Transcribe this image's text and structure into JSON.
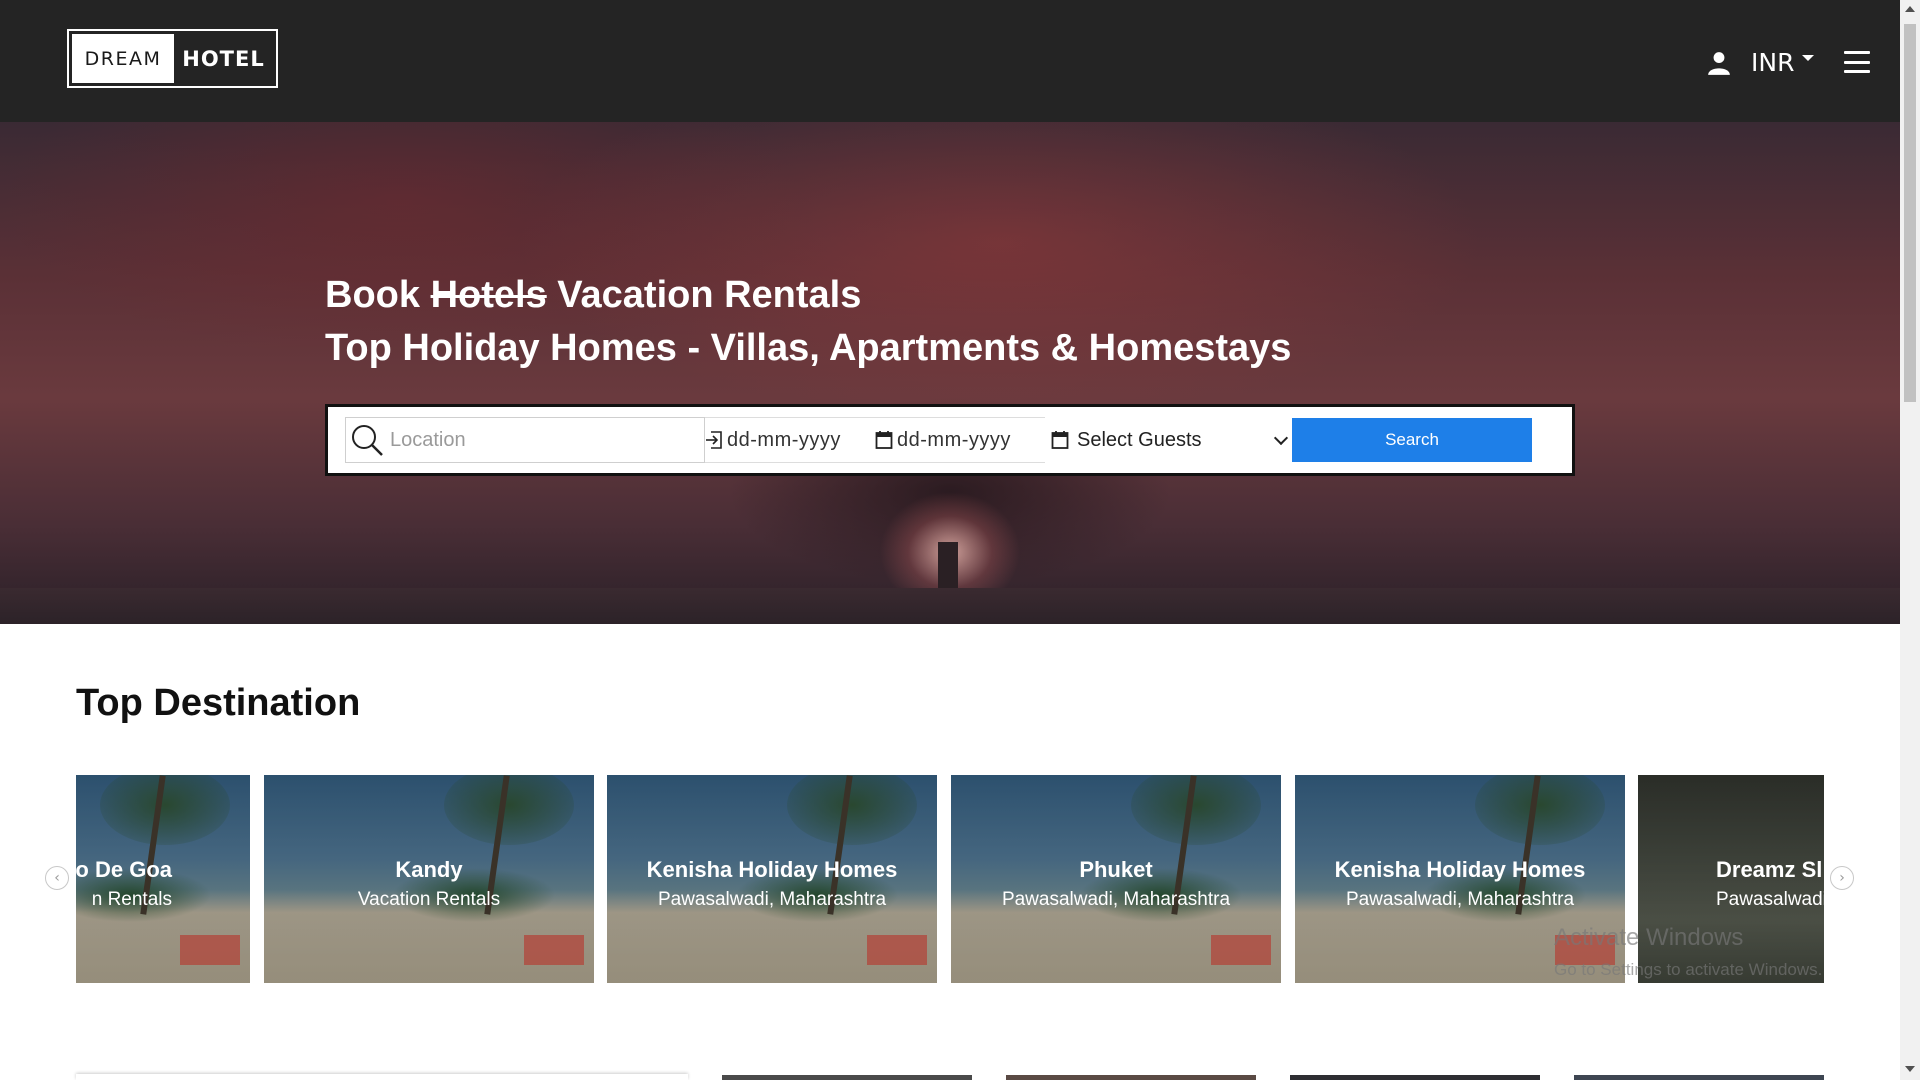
{
  "header": {
    "logo_left": "DREAM",
    "logo_right": "HOTEL",
    "currency": "INR",
    "icons": {
      "user": "user-icon",
      "menu": "hamburger-menu-icon",
      "currency_caret": "caret-down-icon"
    }
  },
  "hero": {
    "title_word_1": "Book",
    "title_struck": "Hotels",
    "title_word_3": "Vacation Rentals",
    "subtitle": "Top Holiday Homes - Villas, Apartments & Homestays"
  },
  "search": {
    "location_placeholder": "Location",
    "checkin_value": "dd-mm-yyyy",
    "checkout_value": "dd-mm-yyyy",
    "guests_value": "Select Guests",
    "button_label": "Search",
    "accent_color": "#1e7fe8"
  },
  "destinations": {
    "title": "Top Destination",
    "cards": [
      {
        "title": "o De Goa",
        "subtitle": "n Rentals"
      },
      {
        "title": "Kandy",
        "subtitle": "Vacation Rentals"
      },
      {
        "title": "Kenisha Holiday Homes",
        "subtitle": "Pawasalwadi, Maharashtra"
      },
      {
        "title": "Phuket",
        "subtitle": "Pawasalwadi, Maharashtra"
      },
      {
        "title": "Kenisha Holiday Homes",
        "subtitle": "Pawasalwadi, Maharashtra"
      },
      {
        "title": "Dreamz Sl",
        "subtitle": "Pawasalwadi, M"
      }
    ],
    "prev_icon": "chevron-left-icon",
    "next_icon": "chevron-right-icon"
  },
  "watermark": {
    "line1": "Activate Windows",
    "line2": "Go to Settings to activate Windows."
  }
}
